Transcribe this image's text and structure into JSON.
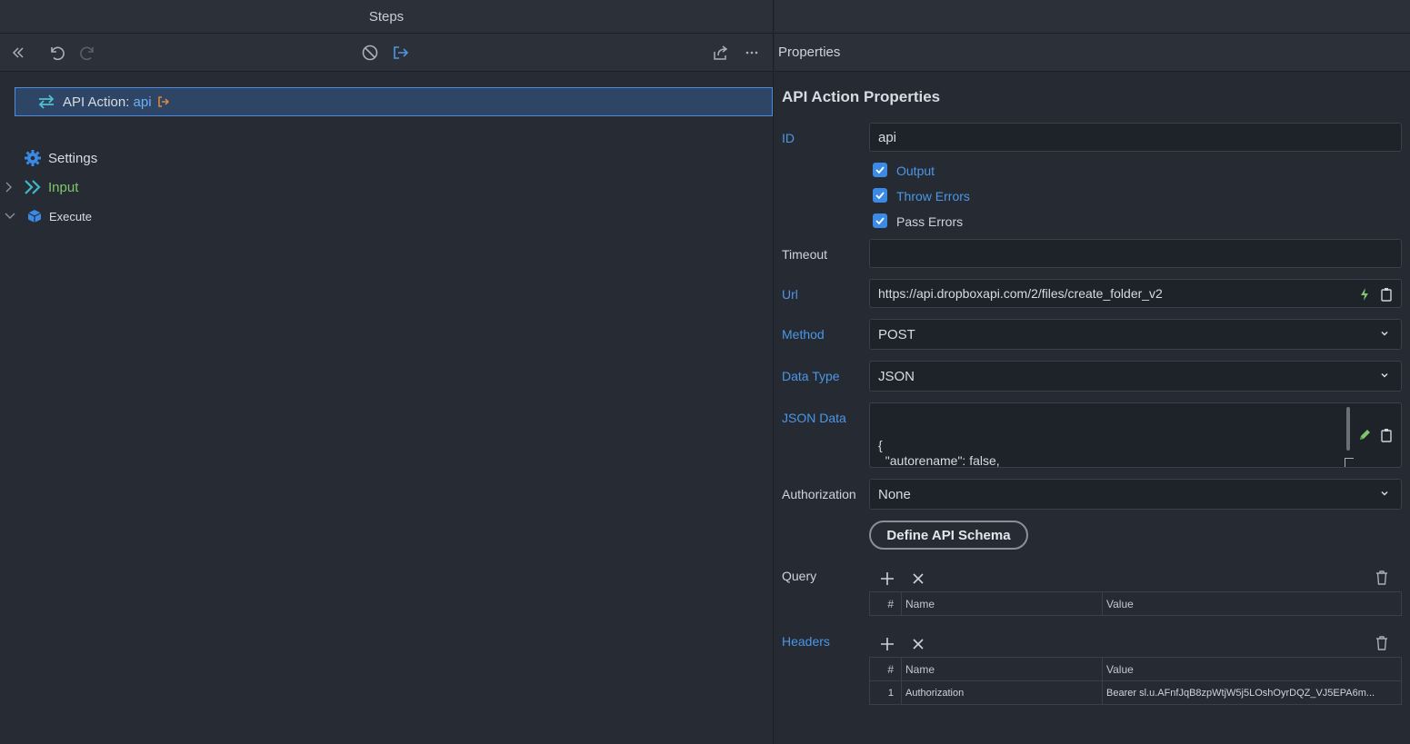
{
  "left_panel": {
    "title": "Steps",
    "tree": {
      "settings": "Settings",
      "input": "Input",
      "execute": "Execute",
      "api_action_prefix": "API Action: ",
      "api_action_id": "api"
    }
  },
  "right_panel": {
    "header": "Properties",
    "section_title": "API Action Properties",
    "fields": {
      "id": {
        "label": "ID",
        "value": "api"
      },
      "output": {
        "label": "Output",
        "checked": true
      },
      "throw_errors": {
        "label": "Throw Errors",
        "checked": true
      },
      "pass_errors": {
        "label": "Pass Errors",
        "checked": true
      },
      "timeout": {
        "label": "Timeout",
        "value": ""
      },
      "url": {
        "label": "Url",
        "value": "https://api.dropboxapi.com/2/files/create_folder_v2"
      },
      "method": {
        "label": "Method",
        "value": "POST"
      },
      "data_type": {
        "label": "Data Type",
        "value": "JSON"
      },
      "json_data": {
        "label": "JSON Data",
        "value": "{\n  \"autorename\": false,\n  \"path\": \"/Homework/math\"\n}"
      },
      "authorization": {
        "label": "Authorization",
        "value": "None"
      }
    },
    "define_schema_button": "Define API Schema",
    "query": {
      "label": "Query",
      "columns": [
        "#",
        "Name",
        "Value"
      ],
      "rows": []
    },
    "headers": {
      "label": "Headers",
      "columns": [
        "#",
        "Name",
        "Value"
      ],
      "rows": [
        {
          "index": "1",
          "name": "Authorization",
          "value": "Bearer sl.u.AFnfJqB8zpWtjW5j5LOshOyrDQZ_VJ5EPA6m..."
        }
      ]
    }
  },
  "colors": {
    "accent_blue": "#4c97e6",
    "input_green": "#7ec86b",
    "selection_bg": "#2e4566",
    "action_orange": "#e08a3c"
  }
}
